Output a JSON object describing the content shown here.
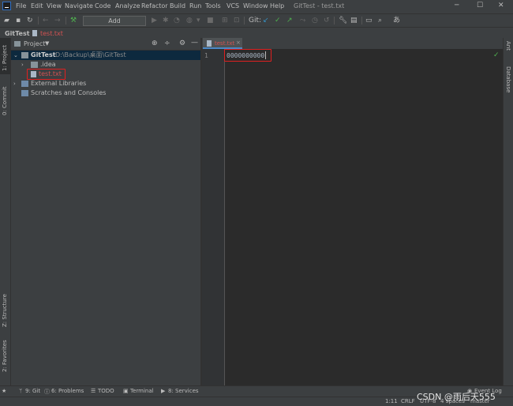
{
  "menu": [
    "File",
    "Edit",
    "View",
    "Navigate",
    "Code",
    "Analyze",
    "Refactor",
    "Build",
    "Run",
    "Tools",
    "VCS",
    "Window",
    "Help"
  ],
  "window_title": "GitTest - test.txt",
  "toolbar": {
    "add_configuration": "Add Configuration...",
    "git_label": "Git:"
  },
  "breadcrumb": {
    "project": "GitTest",
    "file": "test.txt"
  },
  "left_strip": {
    "project": "1: Project",
    "commit": "0: Commit",
    "structure": "Z: Structure",
    "favorites": "2: Favorites"
  },
  "right_strip": {
    "ant": "Ant",
    "database": "Database"
  },
  "project_panel": {
    "title": "Project",
    "tree": {
      "root": {
        "name": "GitTest",
        "path": "D:\\Backup\\桌面\\GitTest"
      },
      "idea": ".idea",
      "file": "test.txt",
      "external": "External Libraries",
      "scratches": "Scratches and Consoles"
    }
  },
  "editor": {
    "tab": "test.txt",
    "line_number": "1",
    "content": "0000000000"
  },
  "bottom_tools": {
    "git": "9: Git",
    "problems": "6: Problems",
    "todo": "TODO",
    "terminal": "Terminal",
    "services": "8: Services",
    "event_log": "Event Log"
  },
  "status": {
    "position": "1:11",
    "line_sep": "CRLF",
    "encoding": "UTF-8",
    "indent": "4 spaces",
    "branch": "master"
  },
  "watermark": "CSDN @雨后天555",
  "colors": {
    "selection": "#0d293e",
    "highlight_box": "#e02020",
    "file_red": "#d25252",
    "accent_blue": "#4a88c7"
  }
}
